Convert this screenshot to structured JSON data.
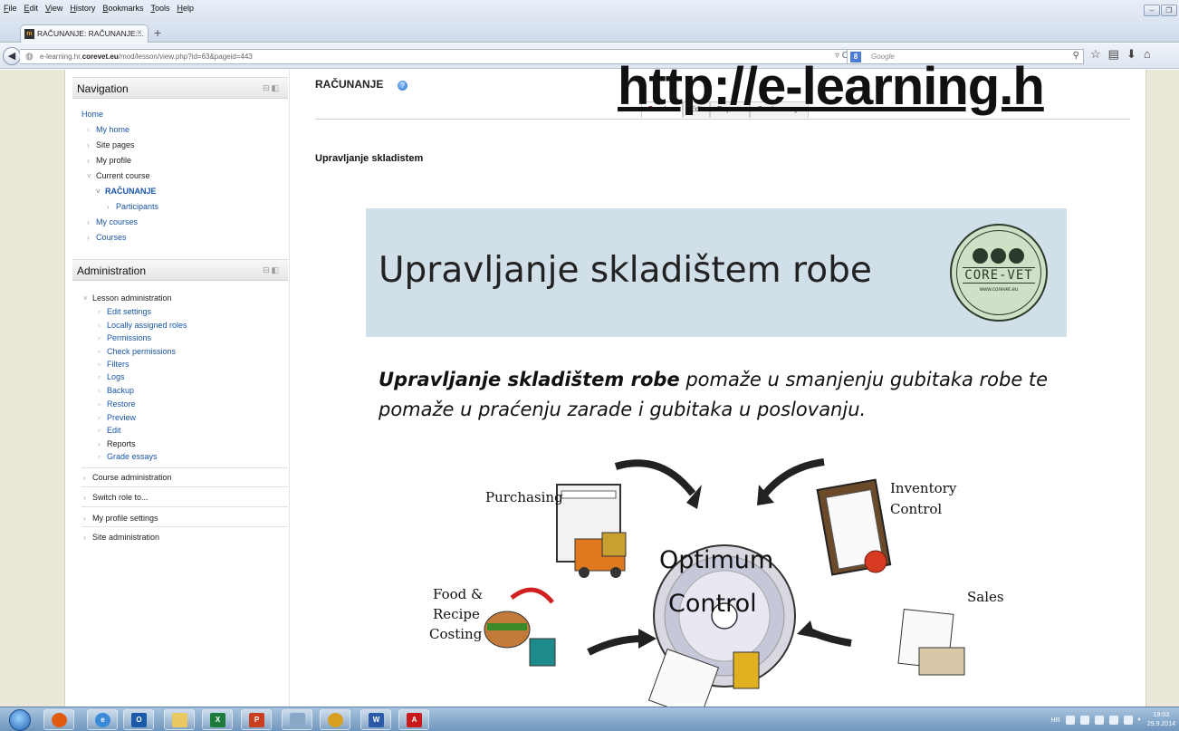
{
  "browser": {
    "menu": [
      "File",
      "Edit",
      "View",
      "History",
      "Bookmarks",
      "Tools",
      "Help"
    ],
    "tab_title": "RAČUNANJE: RAČUNANJE:...",
    "tab_close": "×",
    "new_tab": "+",
    "url_prefix": "e-learning.hr.",
    "url_domain": "corevet.eu",
    "url_path": "/mod/lesson/view.php?id=63&pageid=443",
    "search_placeholder": "Google"
  },
  "sidebar": {
    "navigation": {
      "title": "Navigation",
      "items": [
        {
          "label": "Home"
        },
        {
          "label": "My home"
        },
        {
          "label": "Site pages"
        },
        {
          "label": "My profile"
        },
        {
          "label": "Current course"
        },
        {
          "label": "RAČUNANJE"
        },
        {
          "label": "Participants"
        },
        {
          "label": "My courses"
        },
        {
          "label": "Courses"
        }
      ]
    },
    "administration": {
      "title": "Administration",
      "lesson_admin": "Lesson administration",
      "items": [
        {
          "label": "Edit settings"
        },
        {
          "label": "Locally assigned roles"
        },
        {
          "label": "Permissions"
        },
        {
          "label": "Check permissions"
        },
        {
          "label": "Filters"
        },
        {
          "label": "Logs"
        },
        {
          "label": "Backup"
        },
        {
          "label": "Restore"
        },
        {
          "label": "Preview"
        },
        {
          "label": "Edit"
        },
        {
          "label": "Reports"
        },
        {
          "label": "Grade essays"
        }
      ],
      "sections": [
        {
          "label": "Course administration"
        },
        {
          "label": "Switch role to..."
        },
        {
          "label": "My profile settings"
        },
        {
          "label": "Site administration"
        }
      ]
    }
  },
  "main": {
    "title": "RAČUNANJE",
    "help_icon": "?",
    "tabs": [
      {
        "label": "Preview"
      },
      {
        "label": "Edit"
      },
      {
        "label": "Reports"
      },
      {
        "label": "Grade essays"
      }
    ],
    "page_heading": "Upravljanje skladistem",
    "overlay_url": "http://e-learning.h"
  },
  "slide": {
    "title": "Upravljanje skladištem robe",
    "logo_name": "CORE-VET",
    "logo_site": "www.corevet.eu",
    "text_bold": "Upravljanje skladištem robe",
    "text_rest": " pomaže u smanjenju gubitaka robe te pomaže u praćenju zarade i gubitaka u poslovanju.",
    "diagram": {
      "center_line1": "Optimum",
      "center_line2": "Control",
      "purchasing": "Purchasing",
      "inventory_line1": "Inventory",
      "inventory_line2": "Control",
      "food_line1": "Food &",
      "food_line2": "Recipe",
      "food_line3": "Costing",
      "sales": "Sales"
    }
  },
  "taskbar": {
    "lang": "HR",
    "time": "19:03",
    "date": "29.9.2014"
  }
}
